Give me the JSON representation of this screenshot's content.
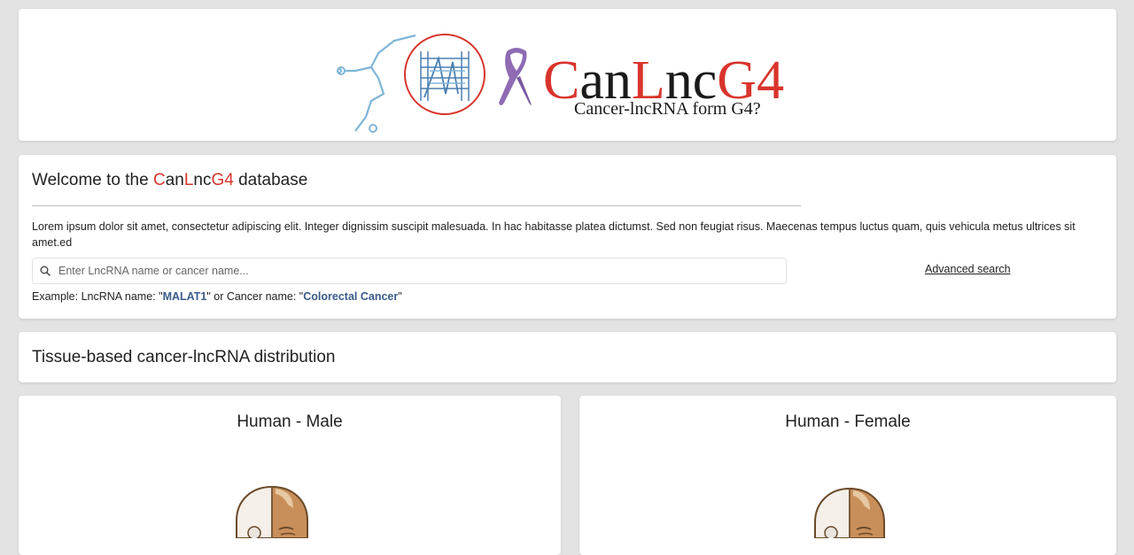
{
  "logo": {
    "brand_parts": [
      {
        "text": "C",
        "color": "#d8342c"
      },
      {
        "text": "an",
        "color": "#1a1a1a"
      },
      {
        "text": "L",
        "color": "#d8342c"
      },
      {
        "text": "nc",
        "color": "#1a1a1a"
      },
      {
        "text": "G4",
        "color": "#d8342c"
      }
    ],
    "tagline": "Cancer-lncRNA form G4?"
  },
  "welcome": {
    "title_prefix": "Welcome to the ",
    "title_brand": [
      {
        "text": "C",
        "color": "#d8342c"
      },
      {
        "text": "an",
        "color": "#222222"
      },
      {
        "text": "L",
        "color": "#d8342c"
      },
      {
        "text": "nc",
        "color": "#222222"
      },
      {
        "text": "G4",
        "color": "#d8342c"
      }
    ],
    "title_suffix": " database",
    "description": "Lorem ipsum dolor sit amet, consectetur adipiscing elit. Integer dignissim suscipit malesuada. In hac habitasse platea dictumst. Sed non feugiat risus. Maecenas tempus luctus quam, quis vehicula metus ultrices sit amet.ed",
    "search_placeholder": "Enter LncRNA name or cancer name...",
    "search_value": "",
    "advanced_search_label": "Advanced search",
    "example_prefix": "Example: LncRNA name: \"",
    "example_lncrna": "MALAT1",
    "example_mid": "\" or Cancer name: \"",
    "example_cancer": "Colorectal Cancer",
    "example_suffix": "\""
  },
  "tissue_section": {
    "title": "Tissue-based cancer-lncRNA distribution"
  },
  "body_maps": [
    {
      "title": "Human - Male"
    },
    {
      "title": "Human - Female"
    }
  ],
  "colors": {
    "accent_red": "#d8342c",
    "ribbon_purple": "#8e6bb3",
    "link_blue": "#3a5a8a",
    "background": "#e4e3e3"
  }
}
